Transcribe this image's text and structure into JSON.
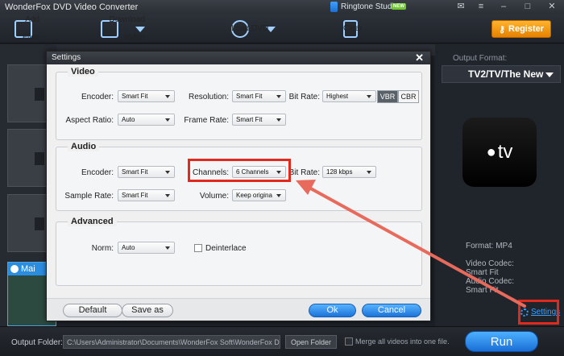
{
  "titlebar": {
    "app_title": "WonderFox DVD Video Converter",
    "ringtone": "Ringtone Studio",
    "new_badge": "NEW"
  },
  "toolbar": {
    "add_files": "Add Files",
    "download_video": "Download Video",
    "load_dvd": "Load DVD",
    "clear": "Clear",
    "register": "Register"
  },
  "left": {
    "main_tag": "Mai"
  },
  "right": {
    "output_format_label": "Output Format:",
    "format_value": "TV2/TV/The New",
    "device_logo": "tv",
    "specs": [
      "Format: MP4",
      "Video Codec:",
      "Smart Fit",
      "Audio Codec:",
      "Smart Fit"
    ],
    "settings_link": "Settings"
  },
  "bottom": {
    "output_folder_label": "Output Folder:",
    "folder_path": "C:\\Users\\Administrator\\Documents\\WonderFox Soft\\WonderFox DVD Vi...",
    "open_folder": "Open Folder",
    "merge_label": "Merge all videos into one file.",
    "run": "Run"
  },
  "dialog": {
    "title": "Settings",
    "video": {
      "title": "Video",
      "encoder_label": "Encoder:",
      "encoder_value": "Smart Fit",
      "resolution_label": "Resolution:",
      "resolution_value": "Smart Fit",
      "bitrate_label": "Bit Rate:",
      "bitrate_value": "Highest",
      "vbr": "VBR",
      "cbr": "CBR",
      "aspect_label": "Aspect Ratio:",
      "aspect_value": "Auto",
      "framerate_label": "Frame Rate:",
      "framerate_value": "Smart Fit"
    },
    "audio": {
      "title": "Audio",
      "encoder_label": "Encoder:",
      "encoder_value": "Smart Fit",
      "channels_label": "Channels:",
      "channels_value": "6 Channels",
      "bitrate_label": "Bit Rate:",
      "bitrate_value": "128 kbps",
      "samplerate_label": "Sample Rate:",
      "samplerate_value": "Smart Fit",
      "volume_label": "Volume:",
      "volume_value": "Keep origina"
    },
    "advanced": {
      "title": "Advanced",
      "norm_label": "Norm:",
      "norm_value": "Auto",
      "deinterlace_label": "Deinterlace"
    },
    "buttons": {
      "default": "Default",
      "save_as": "Save as",
      "ok": "Ok",
      "cancel": "Cancel"
    }
  },
  "colors": {
    "annotation_red": "#e12a1d",
    "accent_blue": "#2b8de0",
    "register_orange": "#f29a10"
  }
}
